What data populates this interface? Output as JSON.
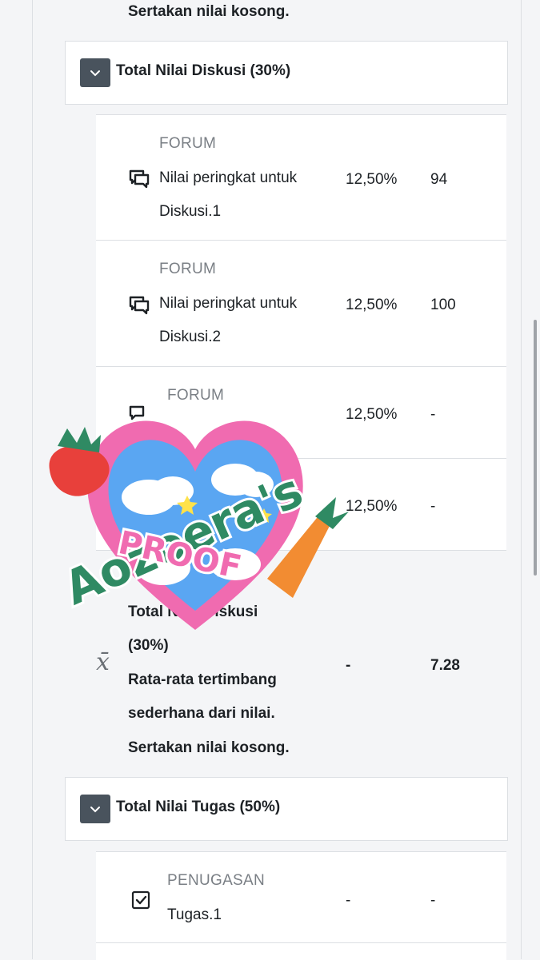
{
  "prev_note": "Sertakan nilai kosong.",
  "categories": [
    {
      "title": "Total Nilai Diskusi (30%)"
    },
    {
      "title": "Total Nilai Tugas (50%)"
    }
  ],
  "forum_items": [
    {
      "type": "FORUM",
      "name_line1": "Nilai peringkat untuk",
      "name_line2": "Diskusi.1",
      "weight": "12,50%",
      "grade": "94"
    },
    {
      "type": "FORUM",
      "name_line1": "Nilai peringkat untuk",
      "name_line2": "Diskusi.2",
      "weight": "12,50%",
      "grade": "100"
    },
    {
      "type": "FORUM",
      "weight": "12,50%",
      "grade": "-"
    },
    {
      "weight": "12,50%",
      "grade": "-"
    }
  ],
  "aggregate": {
    "line1": "Total Nilai Diskusi",
    "line2": "(30%)",
    "line3": "Rata-rata tertimbang",
    "line4": "sederhana dari nilai.",
    "line5": "Sertakan nilai kosong.",
    "weight": "-",
    "grade": "7.28",
    "icon_glyph": "x̄"
  },
  "assignment": {
    "type": "PENUGASAN",
    "name": "Tugas.1",
    "weight": "-",
    "grade": "-"
  },
  "sticker": {
    "text_top": "Aozoera's",
    "text_bottom": "PROOF"
  },
  "colors": {
    "toggle": "#49535d",
    "sticker_pink": "#f06bb0",
    "sticker_green": "#2f8a63"
  }
}
